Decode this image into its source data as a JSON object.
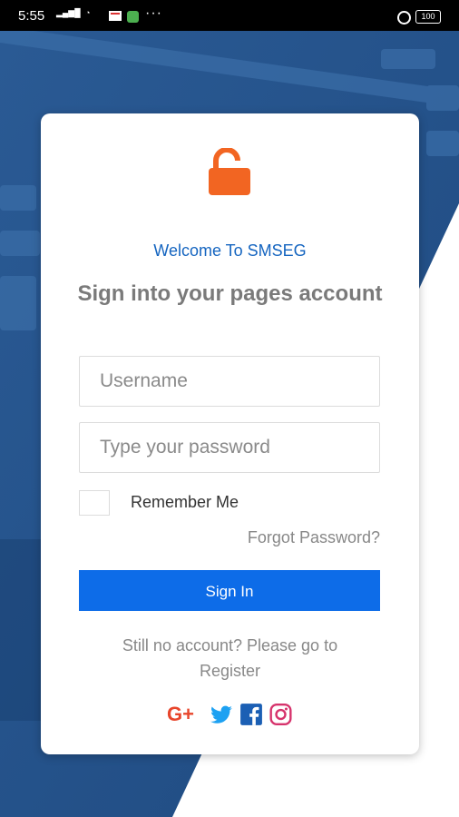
{
  "status_bar": {
    "time": "5:55",
    "battery": "100"
  },
  "login": {
    "welcome": "Welcome To SMSEG",
    "heading": "Sign into your pages account",
    "username_placeholder": "Username",
    "password_placeholder": "Type your password",
    "remember_label": "Remember Me",
    "forgot_label": "Forgot Password?",
    "signin_label": "Sign In",
    "no_account_line1": "Still no account? Please go to",
    "register_link": "Register"
  },
  "social": {
    "google_label": "G+",
    "icons": [
      "google-plus-icon",
      "twitter-icon",
      "facebook-icon",
      "instagram-icon"
    ]
  },
  "colors": {
    "accent": "#0d6ce8",
    "lock": "#f26522",
    "welcome": "#1565c0",
    "background": "#2e5d94"
  }
}
